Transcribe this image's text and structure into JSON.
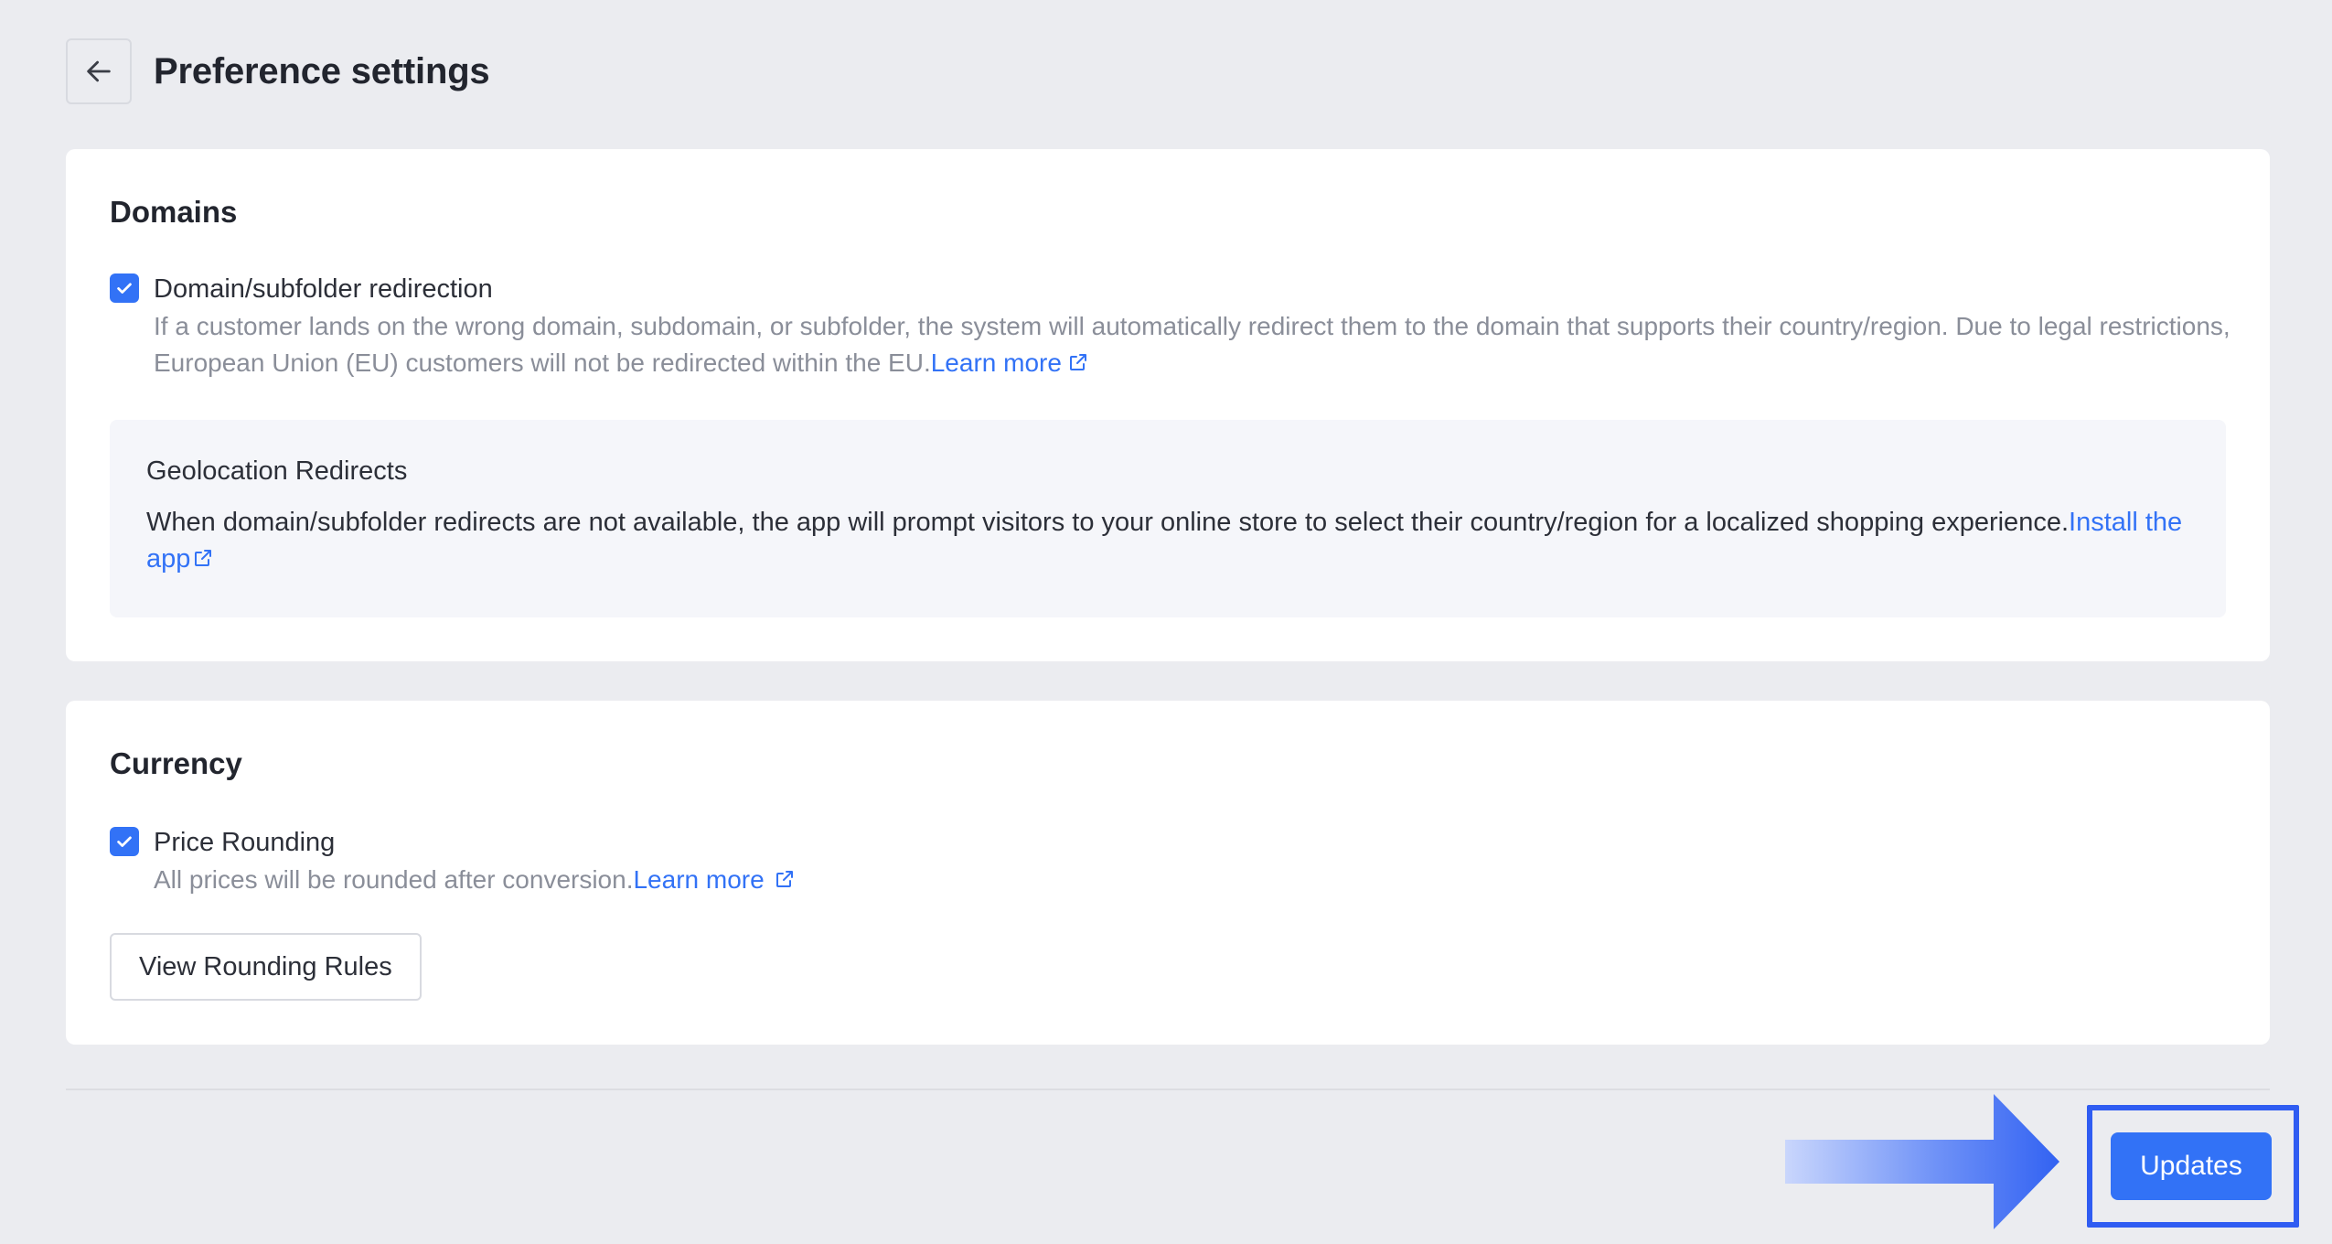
{
  "header": {
    "title": "Preference settings"
  },
  "domains": {
    "title": "Domains",
    "redirect": {
      "label": "Domain/subfolder redirection",
      "checked": true,
      "description": "If a customer lands on the wrong domain, subdomain, or subfolder, the system will automatically redirect them to the domain that supports their country/region. Due to legal restrictions, European Union (EU) customers will not be redirected within the EU.",
      "link": "Learn more"
    },
    "geo": {
      "title": "Geolocation Redirects",
      "description": "When domain/subfolder redirects are not available, the app will prompt visitors to your online store to select their country/region for a localized shopping experience.",
      "link": "Install the app"
    }
  },
  "currency": {
    "title": "Currency",
    "rounding": {
      "label": "Price Rounding",
      "checked": true,
      "description": "All prices will be rounded after conversion.",
      "link": "Learn more"
    },
    "rules_button": "View Rounding Rules"
  },
  "footer": {
    "update_button": "Updates"
  },
  "colors": {
    "accent": "#3272f6",
    "highlight": "#2f5cf2",
    "background": "#ebecf0"
  },
  "icons": {
    "back": "arrow-left-icon",
    "check": "checkmark-icon",
    "external": "external-link-icon",
    "pointer": "arrow-right-icon"
  }
}
